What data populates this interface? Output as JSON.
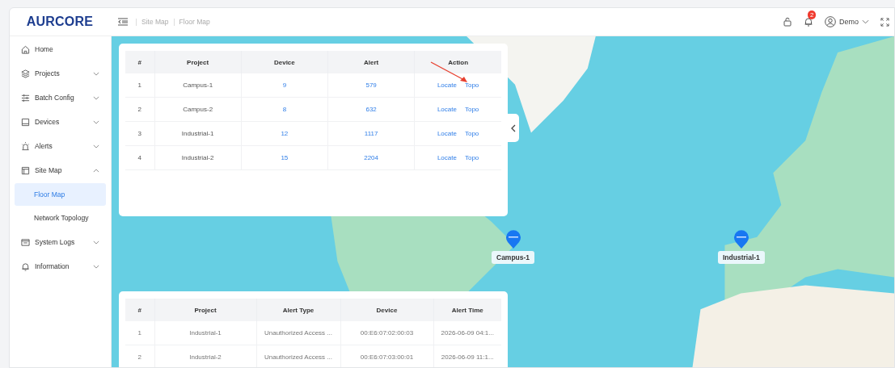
{
  "header": {
    "logo": "AURCORE",
    "breadcrumb": [
      "Site Map",
      "Floor Map"
    ],
    "notification_count": "2",
    "user": "Demo"
  },
  "sidebar": {
    "items": [
      {
        "label": "Home"
      },
      {
        "label": "Projects",
        "expanded": false
      },
      {
        "label": "Batch Config",
        "expanded": false
      },
      {
        "label": "Devices",
        "expanded": false
      },
      {
        "label": "Alerts",
        "expanded": false
      },
      {
        "label": "Site Map",
        "expanded": true,
        "children": [
          {
            "label": "Floor Map",
            "selected": true
          },
          {
            "label": "Network Topology",
            "selected": false
          }
        ]
      },
      {
        "label": "System Logs",
        "expanded": false
      },
      {
        "label": "Information",
        "expanded": false
      }
    ]
  },
  "projects_table": {
    "columns": [
      "#",
      "Project",
      "Device",
      "Alert",
      "Action"
    ],
    "rows": [
      {
        "index": "1",
        "project": "Campus-1",
        "device": "9",
        "alert": "579",
        "actions": [
          "Locate",
          "Topo"
        ]
      },
      {
        "index": "2",
        "project": "Campus-2",
        "device": "8",
        "alert": "632",
        "actions": [
          "Locate",
          "Topo"
        ]
      },
      {
        "index": "3",
        "project": "Industrial-1",
        "device": "12",
        "alert": "1117",
        "actions": [
          "Locate",
          "Topo"
        ]
      },
      {
        "index": "4",
        "project": "Industrial-2",
        "device": "15",
        "alert": "2204",
        "actions": [
          "Locate",
          "Topo"
        ]
      }
    ]
  },
  "alerts_table": {
    "columns": [
      "#",
      "Project",
      "Alert Type",
      "Device",
      "Alert Time"
    ],
    "rows": [
      {
        "index": "1",
        "project": "Industrial-1",
        "alert_type": "Unauthorized Access ...",
        "device": "00:E6:07:02:00:03",
        "alert_time": "2026-06-09 04:1..."
      },
      {
        "index": "2",
        "project": "Industrial-2",
        "alert_type": "Unauthorized Access ...",
        "device": "00:E6:07:03:00:01",
        "alert_time": "2026-06-09 11:1..."
      }
    ]
  },
  "map": {
    "markers": [
      {
        "label": "Campus-1"
      },
      {
        "label": "Industrial-1"
      }
    ]
  }
}
